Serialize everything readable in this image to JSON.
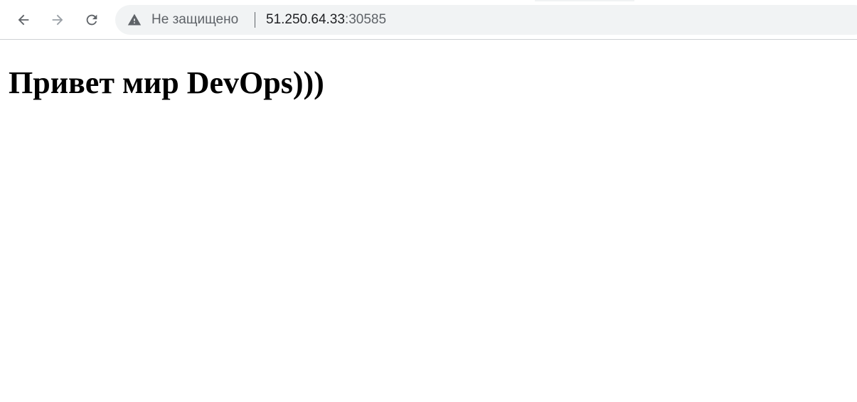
{
  "browser": {
    "nav": {
      "back_icon": "arrow-left-icon",
      "forward_icon": "arrow-right-icon",
      "reload_icon": "reload-icon"
    },
    "omnibox": {
      "security_icon": "warning-triangle-icon",
      "security_label": "Не защищено",
      "url_host": "51.250.64.33",
      "url_port": ":30585"
    },
    "colors": {
      "omnibox_bg": "#f1f3f4",
      "icon_active": "#5f6368",
      "icon_disabled": "#9aa0a6",
      "url_text": "#202124"
    }
  },
  "page": {
    "heading": "Привет мир DevOps)))"
  }
}
